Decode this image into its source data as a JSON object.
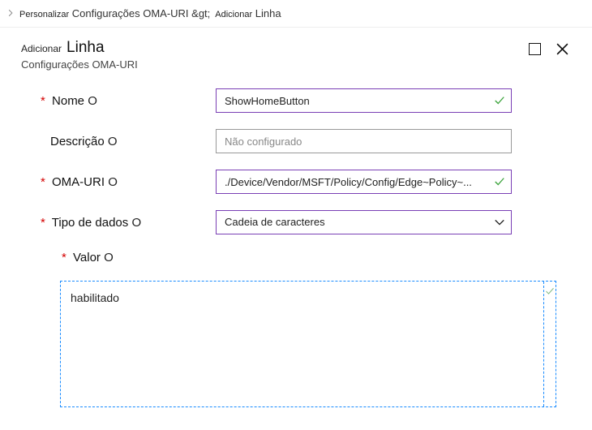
{
  "breadcrumb": {
    "item1_small": "Personalizar",
    "item1_rest": "Configurações OMA-URI &gt;",
    "item2_small": "Adicionar",
    "item2_rest": "Linha"
  },
  "panel": {
    "title_small": "Adicionar",
    "title_big": "Linha",
    "subtitle": "Configurações OMA-URI"
  },
  "form": {
    "nome": {
      "label": "Nome",
      "help": "O",
      "value": "ShowHomeButton"
    },
    "descricao": {
      "label": "Descrição",
      "help": "O",
      "placeholder": "Não configurado"
    },
    "omauri": {
      "label": "OMA-URI",
      "help": "O",
      "value": "./Device/Vendor/MSFT/Policy/Config/Edge~Policy~..."
    },
    "tipo": {
      "label": "Tipo de dados",
      "help": "O",
      "value": "Cadeia de caracteres"
    },
    "valor": {
      "label": "Valor",
      "help": "O",
      "value": "habilitado"
    }
  },
  "glyphs": {
    "required": "*"
  }
}
